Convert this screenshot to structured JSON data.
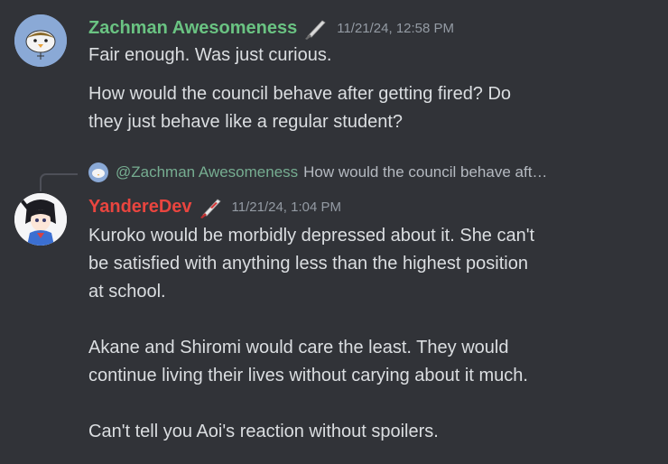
{
  "messages": [
    {
      "username": "Zachman Awesomeness",
      "username_color": "#6ac382",
      "badge_icon": "knife-icon",
      "timestamp": "11/21/24, 12:58 PM",
      "lines": [
        "Fair enough. Was just curious.",
        "How would the council behave after getting fired? Do",
        "they just behave like a regular student?"
      ]
    },
    {
      "reply": {
        "mention": "@Zachman Awesomeness",
        "preview": "How would the council behave aft…"
      },
      "username": "YandereDev",
      "username_color": "#e9453f",
      "badge_icon": "bloody-knife-icon",
      "timestamp": "11/21/24, 1:04 PM",
      "lines": [
        "Kuroko would be morbidly depressed about it. She can't",
        "be satisfied with anything less than the highest position",
        "at school.",
        "",
        "Akane and Shiromi would care the least. They would",
        "continue living their lives without carying about it much.",
        "",
        "Can't tell you Aoi's reaction without spoilers."
      ]
    }
  ]
}
